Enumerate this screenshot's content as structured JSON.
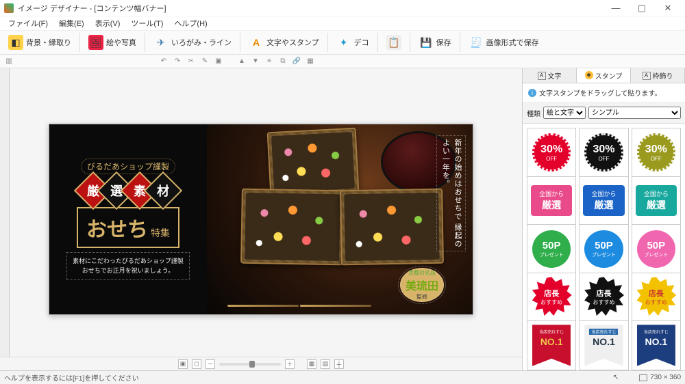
{
  "title": "イメージ デザイナー - [コンテンツ幅バナー]",
  "menu": {
    "file": "ファイル(F)",
    "edit": "編集(E)",
    "view": "表示(V)",
    "tool": "ツール(T)",
    "help": "ヘルプ(H)"
  },
  "toolbar": {
    "bg": "背景・縁取り",
    "photo": "絵や写真",
    "origami": "いろがみ・ライン",
    "text": "文字やスタンプ",
    "deco": "デコ",
    "save": "保存",
    "saveimg": "画像形式で保存"
  },
  "canvas": {
    "ribbon": "びるだあショップ謹製",
    "diamonds": [
      "厳",
      "選",
      "素",
      "材"
    ],
    "osechi": "おせち",
    "tokushu": "特集",
    "desc1": "素材にこだわったびるだあショップ謹製",
    "desc2": "おせちでお正月を祝いましょう。",
    "vtext": "新年の始めはおせちで\n縁起のよい一年を。",
    "stamp_top": "京都の名店",
    "stamp_mid": "美琉田",
    "stamp_bot": "監修"
  },
  "rpanel": {
    "tabs": {
      "text": "文字",
      "stamp": "スタンプ",
      "frame": "枠飾り"
    },
    "info": "文字スタンプをドラッグして貼ります。",
    "type_label": "種類",
    "type_opt": "絵と文字",
    "style_opt": "シンプル"
  },
  "stamps": {
    "off_big": "30%",
    "off_sm": "OFF",
    "sel_t1": "全国から",
    "sel_t2": "厳選",
    "pts_big": "50P",
    "pts_sm": "プレゼント",
    "rec_t1": "店長",
    "rec_t2": "おすすめ",
    "no1_bar": "当店売れすじ",
    "no1": "NO.1"
  },
  "status": {
    "help": "ヘルプを表示するには[F1]を押してください",
    "dim": "730 × 360"
  }
}
